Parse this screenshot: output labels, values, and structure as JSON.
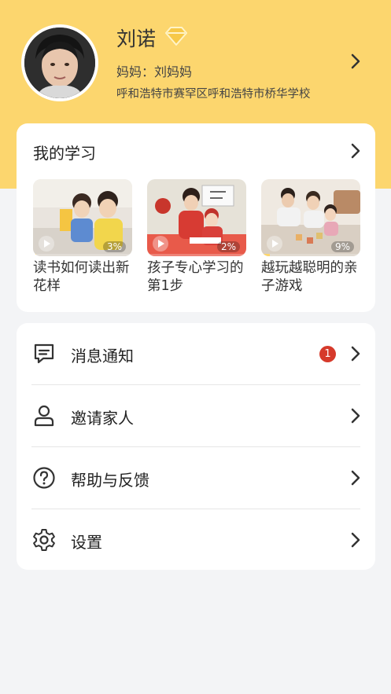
{
  "colors": {
    "header_bg": "#fcd66e",
    "badge": "#d63a2b",
    "page_bg": "#f3f4f6"
  },
  "profile": {
    "name": "刘诺",
    "relation": "妈妈：刘妈妈",
    "school": "呼和浩特市赛罕区呼和浩特市桥华学校",
    "vip_icon": "diamond-icon"
  },
  "study": {
    "title": "我的学习",
    "courses": [
      {
        "title": "读书如何读出新花样",
        "progress": "3%",
        "progress_value": 0.03
      },
      {
        "title": "孩子专心学习的第1步",
        "progress": "2%",
        "progress_value": 0.02
      },
      {
        "title": "越玩越聪明的亲子游戏",
        "progress": "9%",
        "progress_value": 0.09
      }
    ]
  },
  "menu": {
    "items": [
      {
        "label": "消息通知",
        "icon": "message-icon",
        "badge": "1"
      },
      {
        "label": "邀请家人",
        "icon": "person-icon"
      },
      {
        "label": "帮助与反馈",
        "icon": "help-icon"
      },
      {
        "label": "设置",
        "icon": "gear-icon"
      }
    ]
  }
}
